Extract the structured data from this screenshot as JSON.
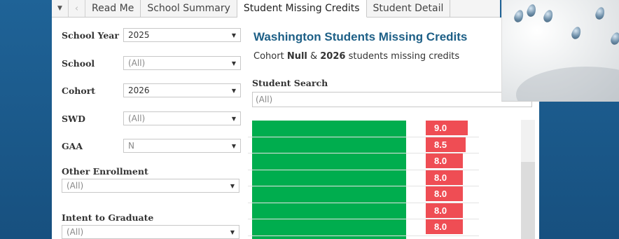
{
  "tabs": {
    "items": [
      "Read Me",
      "School Summary",
      "Student Missing Credits",
      "Student Detail"
    ],
    "active_index": 2
  },
  "filters": {
    "school_year": {
      "label": "School Year",
      "value": "2025"
    },
    "school": {
      "label": "School",
      "value": "(All)"
    },
    "cohort": {
      "label": "Cohort",
      "value": "2026"
    },
    "swd": {
      "label": "SWD",
      "value": "(All)"
    },
    "gaa": {
      "label": "GAA",
      "value": "N"
    },
    "other_enrollment": {
      "label": "Other Enrollment",
      "value": "(All)"
    },
    "intent_to_graduate": {
      "label": "Intent to Graduate",
      "value": "(All)"
    }
  },
  "main": {
    "title": "Washington Students Missing Credits",
    "subtitle_pre": "Cohort ",
    "subtitle_null": "Null",
    "subtitle_mid": " & ",
    "subtitle_year": "2026",
    "subtitle_post": " students missing credits",
    "search_label": "Student Search",
    "search_value": "(All)"
  },
  "chart_data": {
    "type": "bar",
    "title": "",
    "values": [
      9.0,
      8.5,
      8.0,
      8.0,
      8.0,
      8.0,
      8.0
    ],
    "value_labels": [
      "9.0",
      "8.5",
      "8.0",
      "8.0",
      "8.0",
      "8.0",
      "8.0"
    ],
    "xlim": [
      0,
      9.0
    ]
  },
  "colors": {
    "green_bar": "#00ad4e",
    "red_bar": "#ef4d54",
    "title": "#1d5f86"
  },
  "icons": {
    "tab_dropdown": "chevron-down-icon",
    "tab_prev": "chevron-left-icon"
  }
}
